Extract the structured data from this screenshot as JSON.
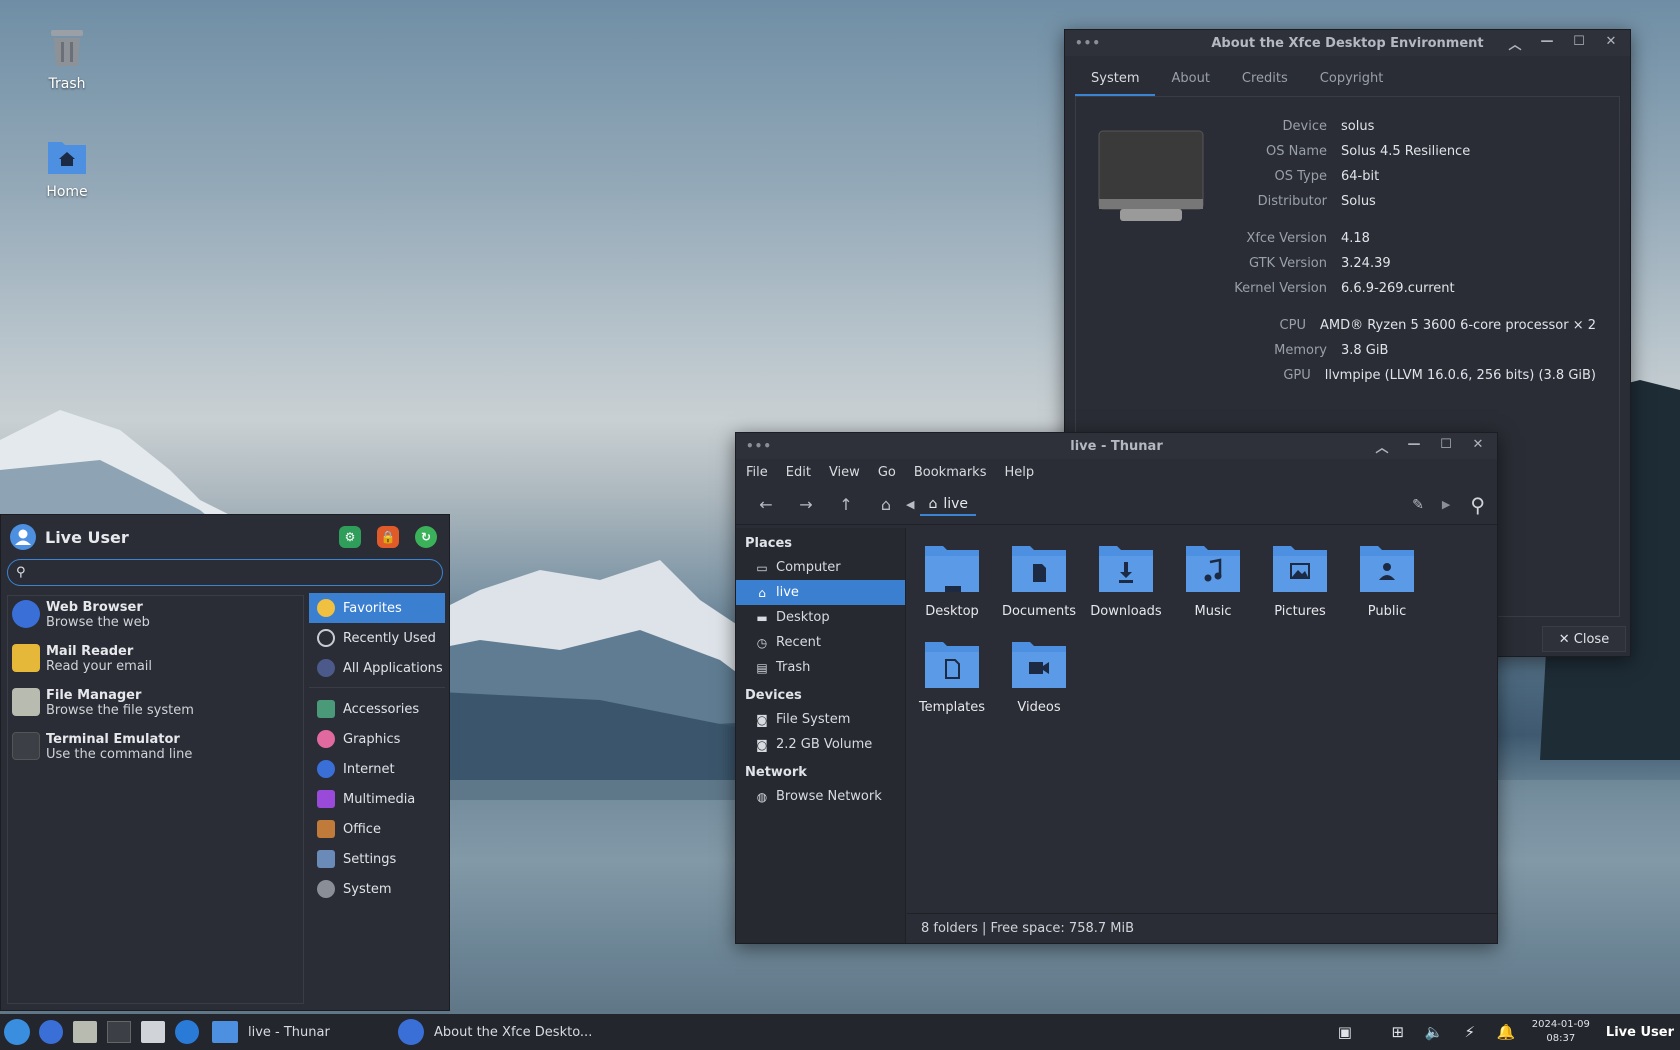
{
  "desktop": {
    "icons": [
      {
        "label": "Trash"
      },
      {
        "label": "Home"
      }
    ]
  },
  "about": {
    "title": "About the Xfce Desktop Environment",
    "tabs": [
      "System",
      "About",
      "Credits",
      "Copyright"
    ],
    "active_tab": "System",
    "rows": [
      {
        "key": "Device",
        "value": "solus"
      },
      {
        "key": "OS Name",
        "value": "Solus 4.5 Resilience"
      },
      {
        "key": "OS Type",
        "value": "64-bit"
      },
      {
        "key": "Distributor",
        "value": "Solus"
      },
      {
        "key": "Xfce Version",
        "value": "4.18"
      },
      {
        "key": "GTK Version",
        "value": "3.24.39"
      },
      {
        "key": "Kernel Version",
        "value": "6.6.9-269.current"
      },
      {
        "key": "CPU",
        "value": "AMD® Ryzen 5 3600 6-core processor × 2"
      },
      {
        "key": "Memory",
        "value": "3.8 GiB"
      },
      {
        "key": "GPU",
        "value": "llvmpipe (LLVM 16.0.6, 256 bits) (3.8 GiB)"
      }
    ],
    "close_label": "✕ Close"
  },
  "thunar": {
    "title": "live - Thunar",
    "menu": [
      "File",
      "Edit",
      "View",
      "Go",
      "Bookmarks",
      "Help"
    ],
    "location": "live",
    "sidebar": {
      "places_head": "Places",
      "places": [
        "Computer",
        "live",
        "Desktop",
        "Recent",
        "Trash"
      ],
      "devices_head": "Devices",
      "devices": [
        "File System",
        "2.2 GB Volume"
      ],
      "network_head": "Network",
      "network": [
        "Browse Network"
      ]
    },
    "folders": [
      "Desktop",
      "Documents",
      "Downloads",
      "Music",
      "Pictures",
      "Public",
      "Templates",
      "Videos"
    ],
    "status": "8 folders  |  Free space: 758.7 MiB"
  },
  "menu": {
    "user": "Live User",
    "search_value": "",
    "favorites": [
      {
        "title": "Web Browser",
        "subtitle": "Browse the web"
      },
      {
        "title": "Mail Reader",
        "subtitle": "Read your email"
      },
      {
        "title": "File Manager",
        "subtitle": "Browse the file system"
      },
      {
        "title": "Terminal Emulator",
        "subtitle": "Use the command line"
      }
    ],
    "categories_top": [
      "Favorites",
      "Recently Used",
      "All Applications"
    ],
    "categories": [
      "Accessories",
      "Graphics",
      "Internet",
      "Multimedia",
      "Office",
      "Settings",
      "System"
    ]
  },
  "taskbar": {
    "tasks": [
      "live - Thunar",
      "About the Xfce Deskto..."
    ],
    "date": "2024-01-09",
    "time": "08:37",
    "user": "Live User"
  },
  "colors": {
    "accent": "#3b7fd0",
    "folder": "#4d8fe0"
  }
}
